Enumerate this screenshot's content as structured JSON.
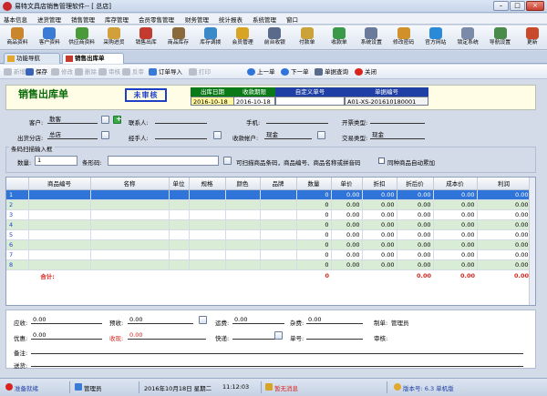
{
  "window": {
    "title": "易特文具店销售管理软件-- [ 总店]",
    "min": "–",
    "max": "□",
    "close": "×"
  },
  "menu": [
    "基本信息",
    "进货管理",
    "销售管理",
    "库存管理",
    "会员零售管理",
    "财务管理",
    "统计报表",
    "系统管理",
    "窗口"
  ],
  "toolbar": [
    {
      "label": "商品资料",
      "icon": "goods-icon",
      "color": "#c9862e"
    },
    {
      "label": "客户资料",
      "icon": "customer-icon",
      "color": "#3a7bd5"
    },
    {
      "label": "供应商资料",
      "icon": "supplier-icon",
      "color": "#4a9a3a"
    },
    {
      "label": "采购进货",
      "icon": "purchase-icon",
      "color": "#d2a03a"
    },
    {
      "label": "销售出库",
      "icon": "sales-out-icon",
      "color": "#c23b2e"
    },
    {
      "label": "商品库存",
      "icon": "stock-icon",
      "color": "#8a6a3a"
    },
    {
      "label": "库存调拨",
      "icon": "transfer-icon",
      "color": "#3a8ac9"
    },
    {
      "label": "会员管理",
      "icon": "member-icon",
      "color": "#d8a424"
    },
    {
      "label": "前台收银",
      "icon": "cashier-icon",
      "color": "#5a6a8a"
    },
    {
      "label": "付款单",
      "icon": "payment-icon",
      "color": "#c9a23a"
    },
    {
      "label": "收款单",
      "icon": "receipt-icon",
      "color": "#3a9a4a"
    },
    {
      "label": "系统设置",
      "icon": "settings-icon",
      "color": "#6a7a9a"
    },
    {
      "label": "修改密码",
      "icon": "password-icon",
      "color": "#d0902a"
    },
    {
      "label": "官方网站",
      "icon": "website-icon",
      "color": "#2a8ad8"
    },
    {
      "label": "锁定系统",
      "icon": "lock-icon",
      "color": "#7a8aa8"
    },
    {
      "label": "导航设置",
      "icon": "nav-settings-icon",
      "color": "#4a8a4a"
    },
    {
      "label": "更新",
      "icon": "update-icon",
      "color": "#c84a2a"
    }
  ],
  "tabs": [
    "功能导航",
    "销售出库单"
  ],
  "formToolbar": {
    "new": "新增",
    "save": "保存",
    "edit": "修改",
    "delete": "删除",
    "audit": "审核",
    "unaudit": "反审",
    "importOrder": "订单导入",
    "print": "打印",
    "prev": "上一单",
    "next": "下一单",
    "query": "单据查询",
    "close": "关闭"
  },
  "header": {
    "title": "销售出库单",
    "status": "未审核",
    "dateLabel": "出库日期",
    "dateValue": "2016-10-18",
    "dueLabel": "收款期限",
    "dueValue": "2016-10-18",
    "customNoLabel": "自定义单号",
    "customNoValue": "",
    "billNoLabel": "单据编号",
    "billNoValue": "A01-XS-201610180001"
  },
  "fields": {
    "customerLabel": "客户:",
    "customerValue": "散客",
    "contactLabel": "联系人:",
    "contactValue": "",
    "phoneLabel": "手机:",
    "phoneValue": "",
    "invoiceLabel": "开票类型:",
    "invoiceValue": "",
    "branchLabel": "出货分店:",
    "branchValue": "总店",
    "handlerLabel": "经手人:",
    "handlerValue": "",
    "accountLabel": "收款帐户:",
    "accountValue": "现金",
    "tradeLabel": "交易类型:",
    "tradeValue": "现金"
  },
  "barcode": {
    "groupTitle": "条码扫描输入框",
    "qtyLabel": "数量:",
    "qtyValue": "1",
    "codeLabel": "条形码:",
    "codeValue": "",
    "hint": "可扫描商品条码，商品编号、商品名称或拼音码",
    "autoAddLabel": "同种商品自动累加"
  },
  "table": {
    "columns": [
      "",
      "商品编号",
      "名称",
      "单位",
      "规格",
      "颜色",
      "品牌",
      "数量",
      "单价",
      "折扣",
      "折后价",
      "成本价",
      "利润"
    ],
    "rows": [
      [
        "1",
        "",
        "",
        "",
        "",
        "",
        "",
        "0",
        "0.00",
        "0.00",
        "0.00",
        "0.00",
        "0.00"
      ],
      [
        "2",
        "",
        "",
        "",
        "",
        "",
        "",
        "0",
        "0.00",
        "0.00",
        "0.00",
        "0.00",
        "0.00"
      ],
      [
        "3",
        "",
        "",
        "",
        "",
        "",
        "",
        "0",
        "0.00",
        "0.00",
        "0.00",
        "0.00",
        "0.00"
      ],
      [
        "4",
        "",
        "",
        "",
        "",
        "",
        "",
        "0",
        "0.00",
        "0.00",
        "0.00",
        "0.00",
        "0.00"
      ],
      [
        "5",
        "",
        "",
        "",
        "",
        "",
        "",
        "0",
        "0.00",
        "0.00",
        "0.00",
        "0.00",
        "0.00"
      ],
      [
        "6",
        "",
        "",
        "",
        "",
        "",
        "",
        "0",
        "0.00",
        "0.00",
        "0.00",
        "0.00",
        "0.00"
      ],
      [
        "7",
        "",
        "",
        "",
        "",
        "",
        "",
        "0",
        "0.00",
        "0.00",
        "0.00",
        "0.00",
        "0.00"
      ],
      [
        "8",
        "",
        "",
        "",
        "",
        "",
        "",
        "0",
        "0.00",
        "0.00",
        "0.00",
        "0.00",
        "0.00"
      ]
    ],
    "totalLabel": "合计:",
    "totalQty": "0",
    "totalDiscounted": "0.00",
    "totalCost": "0.00",
    "totalProfit": "0.00"
  },
  "footer": {
    "receivableLabel": "应收:",
    "receivableValue": "0.00",
    "prepaidLabel": "预收:",
    "prepaidValue": "0.00",
    "freightLabel": "运费:",
    "freightValue": "0.00",
    "miscLabel": "杂费:",
    "miscValue": "0.00",
    "makerLabel": "制单:",
    "makerValue": "管理员",
    "discountLabel": "优惠:",
    "discountValue": "0.00",
    "receivedLabel": "收现:",
    "receivedValue": "0.00",
    "expressLabel": "快递:",
    "expressValue": "",
    "trackingLabel": "单号:",
    "trackingValue": "",
    "auditorLabel": "审核:",
    "auditorValue": "",
    "remarkLabel": "备注:",
    "remarkValue": "",
    "deliveryLabel": "送货:",
    "deliveryValue": ""
  },
  "status": {
    "ready": "准备就绪",
    "user": "管理员",
    "datetime": "2016年10月18日 星期二",
    "time": "11:12:03",
    "message": "暂无消息",
    "version": "版本号: 6.3 单机版"
  }
}
